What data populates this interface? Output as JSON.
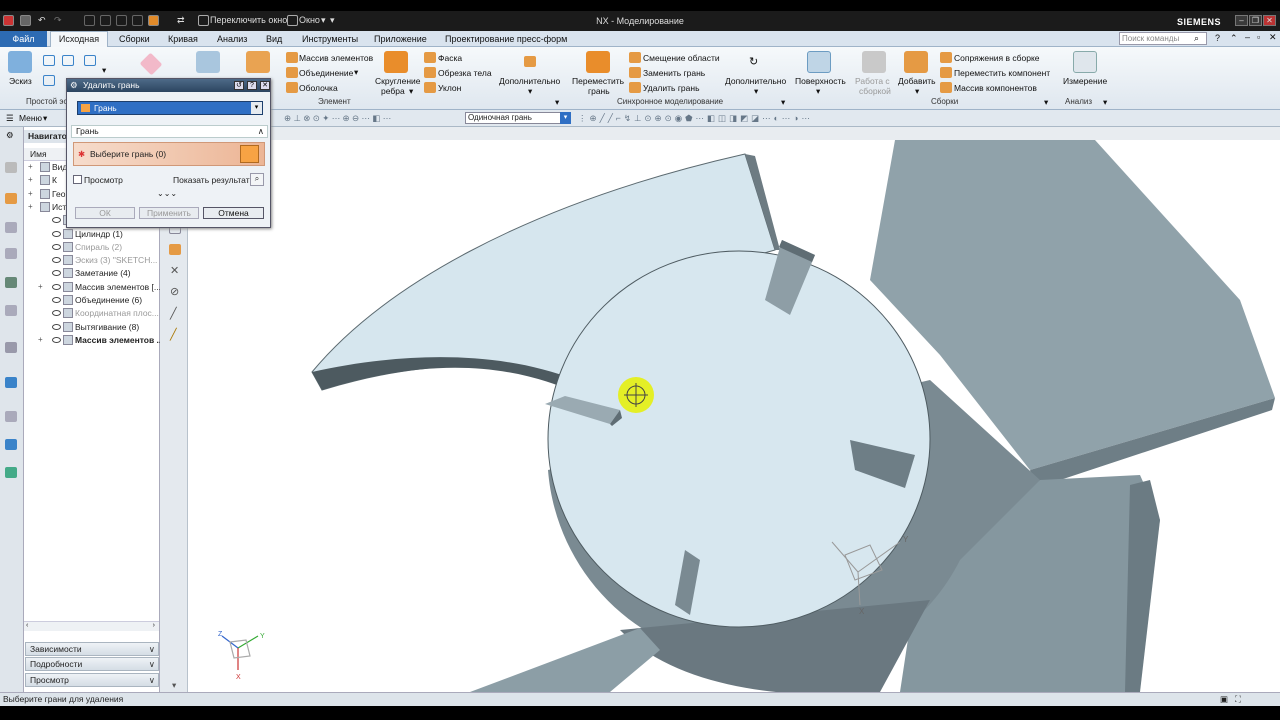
{
  "titlebar": {
    "title": "NX - Моделирование",
    "switch_window": "Переключить окно",
    "window_menu": "Окно",
    "brand": "SIEMENS"
  },
  "menubar": {
    "tabs": [
      "Файл",
      "Исходная",
      "Сборки",
      "Кривая",
      "Анализ",
      "Вид",
      "Инструменты",
      "Приложение",
      "Проектирование пресс-форм"
    ],
    "search_placeholder": "Поиск команды"
  },
  "ribbon": {
    "sketch": "Эскиз",
    "group_simple": "Простой эс",
    "pattern_features": "Массив элементов",
    "unite": "Объединение",
    "shell": "Оболочка",
    "edge_blend_l1": "Скругление",
    "edge_blend_l2": "ребра",
    "chamfer": "Фаска",
    "trim_body": "Обрезка тела",
    "draft": "Уклон",
    "more1": "Дополнительно",
    "group_feature": "Элемент",
    "move_face_l1": "Переместить",
    "move_face_l2": "грань",
    "offset_region": "Смещение области",
    "replace_face": "Заменить грань",
    "delete_face": "Удалить грань",
    "more2": "Дополнительно",
    "group_sync": "Синхронное моделирование",
    "surface": "Поверхность",
    "work_in_assy_l1": "Работа с",
    "work_in_assy_l2": "сборкой",
    "add": "Добавить",
    "assy_constraints": "Сопряжения в сборке",
    "move_component": "Переместить компонент",
    "component_pattern": "Массив компонентов",
    "group_assemblies": "Сборки",
    "measure": "Измерение",
    "group_analysis": "Анализ"
  },
  "toolbar2": {
    "menu": "Меню",
    "face_rule": "Одиночная грань"
  },
  "navigator": {
    "title": "Навигатор",
    "col_name": "Имя",
    "rows": [
      {
        "label": "Вид",
        "style": "normal"
      },
      {
        "label": "К",
        "style": "normal"
      },
      {
        "label": "Гео",
        "style": "normal"
      },
      {
        "label": "Ист",
        "style": "normal"
      },
      {
        "label": "",
        "style": "normal"
      },
      {
        "label": "Цилиндр (1)",
        "style": "normal"
      },
      {
        "label": "Спираль (2)",
        "style": "gray"
      },
      {
        "label": "Эскиз (3) \"SKETCH...",
        "style": "gray"
      },
      {
        "label": "Заметание (4)",
        "style": "normal"
      },
      {
        "label": "Массив элементов [...",
        "style": "normal"
      },
      {
        "label": "Объединение (6)",
        "style": "normal"
      },
      {
        "label": "Координатная плос...",
        "style": "gray"
      },
      {
        "label": "Вытягивание (8)",
        "style": "normal"
      },
      {
        "label": "Массив элементов ...",
        "style": "bold"
      }
    ],
    "panels": [
      "Зависимости",
      "Подробности",
      "Просмотр"
    ]
  },
  "dialog": {
    "title": "Удалить грань",
    "type_value": "Грань",
    "section": "Грань",
    "select_face": "Выберите грань (0)",
    "preview": "Просмотр",
    "show_result": "Показать результат",
    "ok": "ОК",
    "apply": "Применить",
    "cancel": "Отмена"
  },
  "status": {
    "text": "Выберите грани для удаления"
  },
  "triad": {
    "x": "X",
    "y": "Y",
    "z": "Z"
  },
  "colors": {
    "accent": "#2d6bb3",
    "face_light": "#d6e6ee",
    "face_dark": "#7f8f96",
    "cursor": "#e6f010"
  }
}
